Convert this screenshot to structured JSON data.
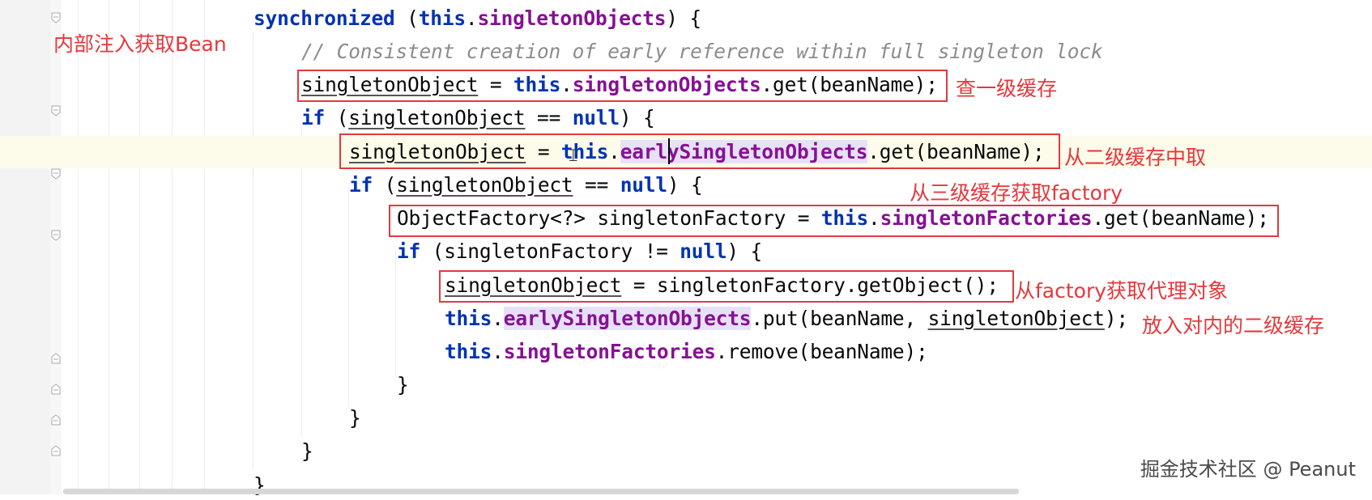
{
  "code": {
    "l1": {
      "kw": "synchronized",
      "a": " (",
      "kw2": "this",
      "dot": ".",
      "fld": "singletonObjects",
      "b": ") {"
    },
    "l2": {
      "comment": "// Consistent creation of early reference within full singleton lock"
    },
    "l3": {
      "var": "singletonObject",
      "a": " = ",
      "kw": "this",
      "dot": ".",
      "fld": "singletonObjects",
      "b": ".get(beanName);"
    },
    "l4": {
      "kw": "if",
      "a": " (",
      "var": "singletonObject",
      "b": " == ",
      "kw2": "null",
      "c": ") {"
    },
    "l5": {
      "var": "singletonObject",
      "a": " = ",
      "kw": "this",
      "dot": ".",
      "fld": "earlySingletonObjects",
      "b": ".get(beanName);"
    },
    "l6": {
      "kw": "if",
      "a": " (",
      "var": "singletonObject",
      "b": " == ",
      "kw2": "null",
      "c": ") {"
    },
    "l7": {
      "a": "ObjectFactory<?> singletonFactory = ",
      "kw": "this",
      "dot": ".",
      "fld": "singletonFactories",
      "b": ".get(beanName);"
    },
    "l8": {
      "kw": "if",
      "a": " (singletonFactory != ",
      "kw2": "null",
      "b": ") {"
    },
    "l9": {
      "var": "singletonObject",
      "a": " = singletonFactory.getObject();"
    },
    "l10": {
      "kw": "this",
      "dot": ".",
      "fld": "earlySingletonObjects",
      "a": ".put(beanName, ",
      "var": "singletonObject",
      "b": ");"
    },
    "l11": {
      "kw": "this",
      "dot": ".",
      "fld": "singletonFactories",
      "a": ".remove(beanName);"
    },
    "brace": "}"
  },
  "annotations": {
    "inner_inject": "内部注入获取Bean",
    "check_level1": "查一级缓存",
    "from_level2": "从二级缓存中取",
    "from_level3": "从三级缓存获取factory",
    "from_factory": "从factory获取代理对象",
    "put_level2": "放入对内的二级缓存"
  },
  "watermark": "掘金技术社区 @ Peanut",
  "colors": {
    "annotation": "#e5383c",
    "keyword": "#0033b3",
    "field": "#871094",
    "comment": "#8c8c8c"
  }
}
